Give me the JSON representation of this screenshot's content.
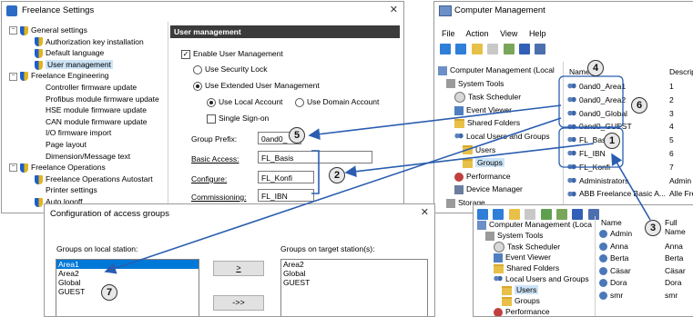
{
  "freelance": {
    "title": "Freelance Settings",
    "close": "✕",
    "tree": [
      {
        "label": "General settings",
        "expander": "−",
        "icon": "shield-icon",
        "level": 0
      },
      {
        "label": "Authorization key installation",
        "icon": "shield-icon",
        "level": 1
      },
      {
        "label": "Default language",
        "icon": "shield-icon",
        "level": 1
      },
      {
        "label": "User management",
        "icon": "shield-icon",
        "level": 1,
        "selected": true
      },
      {
        "label": "Freelance Engineering",
        "expander": "−",
        "icon": "shield-icon",
        "level": 0
      },
      {
        "label": "Controller firmware update",
        "level": 1
      },
      {
        "label": "Profibus module firmware update",
        "level": 1
      },
      {
        "label": "HSE module firmware update",
        "level": 1
      },
      {
        "label": "CAN module firmware update",
        "level": 1
      },
      {
        "label": "I/O firmware import",
        "level": 1
      },
      {
        "label": "Page layout",
        "level": 1
      },
      {
        "label": "Dimension/Message text",
        "level": 1
      },
      {
        "label": "Freelance Operations",
        "expander": "−",
        "icon": "shield-icon",
        "level": 0
      },
      {
        "label": "Freelance Operations Autostart",
        "icon": "shield-icon",
        "level": 1
      },
      {
        "label": "Printer settings",
        "level": 1
      },
      {
        "label": "Auto logoff",
        "icon": "shield-icon",
        "level": 1
      }
    ],
    "panel_title": "User management",
    "enable_label": "Enable User Management",
    "security_lock_label": "Use Security Lock",
    "extended_label": "Use Extended User Management",
    "local_account_label": "Use Local Account",
    "domain_account_label": "Use Domain Account",
    "sso_label": "Single Sign-on",
    "group_prefix_label": "Group Prefix:",
    "group_prefix_value": "0and0_",
    "basic_access_label": "Basic Access:",
    "basic_access_value": "FL_Basis",
    "configure_label": "Configure:",
    "configure_value": "FL_Konfi",
    "commissioning_label": "Commissioning:",
    "commissioning_value": "FL_IBN"
  },
  "access_dialog": {
    "title": "Configuration of access groups",
    "close": "✕",
    "local_label": "Groups on local station:",
    "target_label": "Groups on target station(s):",
    "local_groups": [
      "Area1",
      "Area2",
      "Global",
      "GUEST"
    ],
    "target_groups": [
      "Area2",
      "Global",
      "GUEST"
    ],
    "btn_single": ">",
    "btn_all": "->>"
  },
  "computer_mgmt": {
    "title": "Computer Management",
    "menu": [
      "File",
      "Action",
      "View",
      "Help"
    ],
    "tree": [
      {
        "label": "Computer Management (Local",
        "level": 0
      },
      {
        "label": "System Tools",
        "level": 1
      },
      {
        "label": "Task Scheduler",
        "level": 2
      },
      {
        "label": "Event Viewer",
        "level": 2
      },
      {
        "label": "Shared Folders",
        "level": 2
      },
      {
        "label": "Local Users and Groups",
        "level": 2
      },
      {
        "label": "Users",
        "level": 3
      },
      {
        "label": "Groups",
        "level": 3,
        "selected": true
      },
      {
        "label": "Performance",
        "level": 2
      },
      {
        "label": "Device Manager",
        "level": 2
      },
      {
        "label": "Storage",
        "level": 1
      }
    ],
    "col_name": "Name",
    "col_desc": "Descripti",
    "groups": [
      {
        "name": "0and0_Area1",
        "desc": "1"
      },
      {
        "name": "0and0_Area2",
        "desc": "2"
      },
      {
        "name": "0and0_Global",
        "desc": "3"
      },
      {
        "name": "0and0_GUEST",
        "desc": "4"
      },
      {
        "name": "FL_Basis",
        "desc": "5"
      },
      {
        "name": "FL_IBN",
        "desc": "6"
      },
      {
        "name": "FL_Konfi",
        "desc": "7"
      },
      {
        "name": "Administrators",
        "desc": "Admin"
      },
      {
        "name": "ABB Freelance Basic A...",
        "desc": "Alle Fre"
      }
    ]
  },
  "computer_mgmt_users": {
    "tree": [
      {
        "label": "Computer Management (Loca",
        "level": 0
      },
      {
        "label": "System Tools",
        "level": 1
      },
      {
        "label": "Task Scheduler",
        "level": 2
      },
      {
        "label": "Event Viewer",
        "level": 2
      },
      {
        "label": "Shared Folders",
        "level": 2
      },
      {
        "label": "Local Users and Groups",
        "level": 2
      },
      {
        "label": "Users",
        "level": 3,
        "selected": true
      },
      {
        "label": "Groups",
        "level": 3
      },
      {
        "label": "Performance",
        "level": 2
      }
    ],
    "col_name": "Name",
    "col_fullname": "Full Name",
    "users": [
      {
        "name": "Admin",
        "full": ""
      },
      {
        "name": "Anna",
        "full": "Anna"
      },
      {
        "name": "Berta",
        "full": "Berta"
      },
      {
        "name": "Cäsar",
        "full": "Cäsar"
      },
      {
        "name": "Dora",
        "full": "Dora"
      },
      {
        "name": "smr",
        "full": "smr"
      }
    ]
  },
  "callouts": [
    "1",
    "2",
    "3",
    "4",
    "5",
    "6",
    "7"
  ],
  "colors": {
    "arrow": "#2a5db0",
    "bracket": "#2a5db0",
    "panel_header": "#3b3b3b",
    "selection": "#0078d7"
  }
}
